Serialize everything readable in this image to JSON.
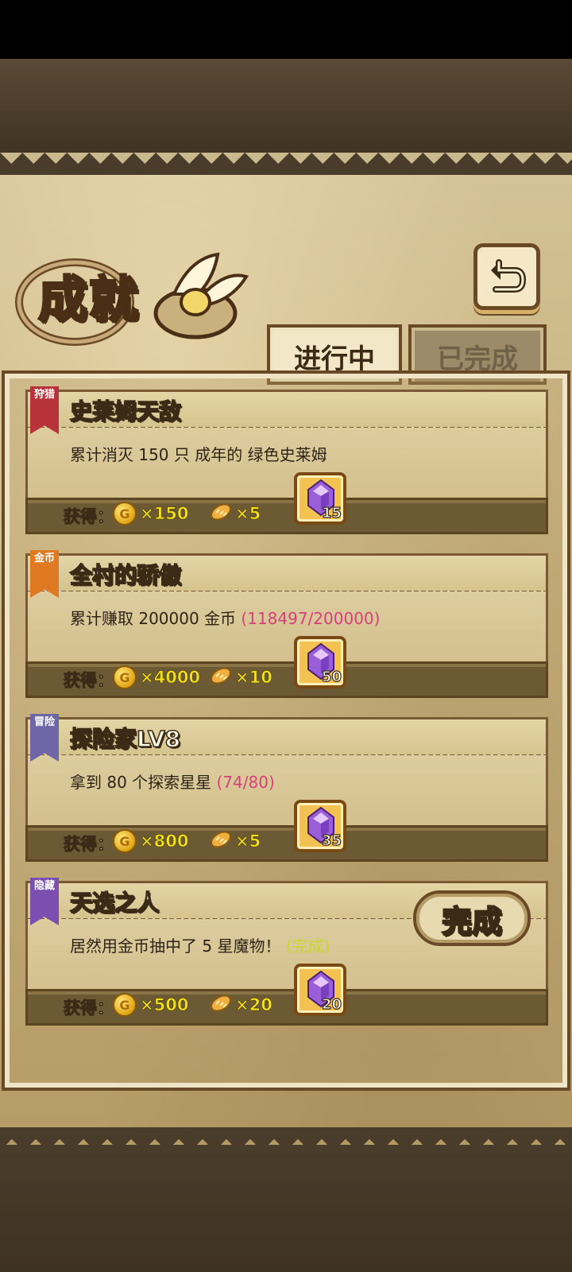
{
  "header": {
    "title": "成就",
    "back_icon": "return-arrow-icon"
  },
  "tabs": [
    {
      "label": "进行中",
      "active": true
    },
    {
      "label": "已完成",
      "active": false
    }
  ],
  "achievements": [
    {
      "ribbon": "狩猎",
      "ribbon_color": "#b8323a",
      "title": "史莱姆天敌",
      "description": "累计消灭 150 只 成年的 绿色史莱姆",
      "progress": "",
      "reward_label": "获得：",
      "coins": "×150",
      "bread": "×5",
      "gems": "15"
    },
    {
      "ribbon": "金币",
      "ribbon_color": "#e07a22",
      "title": "全村的骄傲",
      "description": "累计赚取 200000 金币",
      "progress": "(118497/200000)",
      "reward_label": "获得：",
      "coins": "×4000",
      "bread": "×10",
      "gems": "50"
    },
    {
      "ribbon": "冒险",
      "ribbon_color": "#6e66a6",
      "title": "探险家LV8",
      "description": "拿到 80 个探索星星",
      "progress": "(74/80)",
      "reward_label": "获得：",
      "coins": "×800",
      "bread": "×5",
      "gems": "35"
    },
    {
      "ribbon": "隐藏",
      "ribbon_color": "#7a4fb0",
      "title": "天选之人",
      "description": "居然用金币抽中了 5 星魔物！",
      "progress": "(完成)",
      "reward_label": "获得：",
      "coins": "×500",
      "bread": "×20",
      "gems": "20",
      "complete_button": "完成"
    }
  ]
}
